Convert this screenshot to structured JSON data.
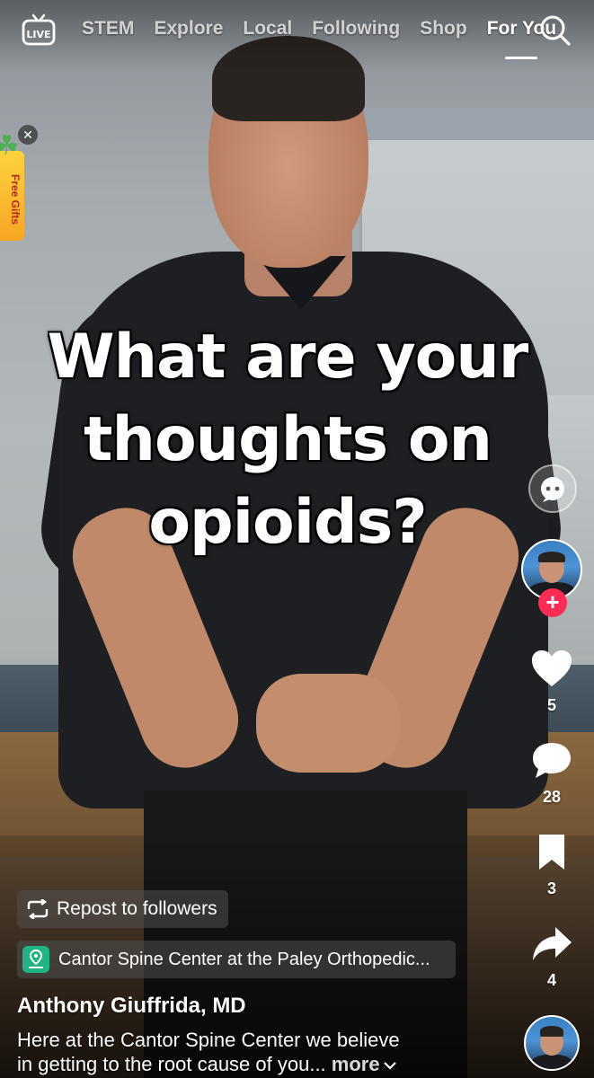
{
  "nav": {
    "live_label": "LIVE",
    "tabs": [
      {
        "label": "STEM",
        "active": false
      },
      {
        "label": "Explore",
        "active": false
      },
      {
        "label": "Local",
        "active": false
      },
      {
        "label": "Following",
        "active": false
      },
      {
        "label": "Shop",
        "active": false
      },
      {
        "label": "For You",
        "active": true
      }
    ],
    "search_icon": "search-icon"
  },
  "promo": {
    "label": "Free Gifts",
    "close_icon": "close-icon"
  },
  "video": {
    "caption_line1": "What are your",
    "caption_line2": "thoughts on",
    "caption_line3": "opioids?"
  },
  "actions": {
    "likes": "5",
    "comments": "28",
    "bookmarks": "3",
    "shares": "4",
    "follow_symbol": "+"
  },
  "post": {
    "repost_label": "Repost to followers",
    "location": "Cantor Spine Center at the Paley Orthopedic...",
    "author": "Anthony Giuffrida, MD",
    "description_line1": "Here at the Cantor Spine Center we believe",
    "description_line2": "in getting to the root cause of you...",
    "more_label": "more"
  },
  "colors": {
    "follow_accent": "#fe2c55",
    "location_icon": "#20b482",
    "gift_tab": "#f6a623"
  }
}
